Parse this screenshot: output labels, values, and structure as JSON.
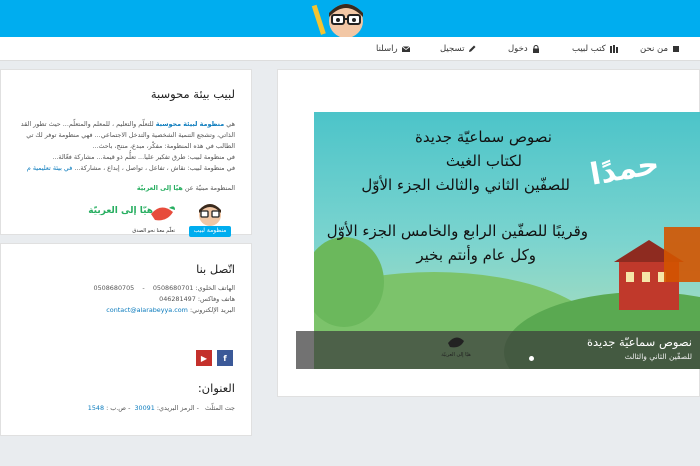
{
  "nav": {
    "items": [
      {
        "label": "من نحن",
        "icon": "book-icon"
      },
      {
        "label": "كتب لبيب",
        "icon": "books-icon"
      },
      {
        "label": "دخول",
        "icon": "lock-icon"
      },
      {
        "label": "تسجيل",
        "icon": "pencil-icon"
      },
      {
        "label": "راسلنا",
        "icon": "envelope-icon"
      }
    ]
  },
  "about": {
    "title": "لبيب بيئة محوسبة",
    "line1_pre": "هي ",
    "line1_hl": "منظومة لبيئة محوسبة",
    "line1_post": " للتعلّم والتعليم ، للمعلم والمتعلّم... حيث تطور القد",
    "line2": "الذاتي، وتشجع التنمية الشخصية والتدخل الاجتماعي... فهي منظومة توفر لك تي",
    "line3": "الطالب في هذه المنظومة: مفكّر، مبدع، منتج، باحث...",
    "line4": "في منظومة لبيب: طرق تفكير عليا... تعلُّم ذو قيمة... مشاركة فعّالة...",
    "line5_pre": "في منظومة لبيب: نقاش ، تفاعل ، تواصل ، إبداع ، مشاركة... ",
    "line5_hl": "في بيئة تعليمية م",
    "partner_pre": "المنظومة مبنيّة عن ",
    "partner_hl": "هيّا إلى العربيّة",
    "logo_labib": "منظومة لبيب",
    "logo_hayya": "هيّا إلى العربيّة",
    "logo_hayya_sub": "تعلّم معنا نحو الصدق"
  },
  "contact": {
    "title": "اتّصل بنا",
    "phone_label": "الهاتف الخلوي:",
    "phone1": "0508680701",
    "phone_sep": "-",
    "phone2": "0508680705",
    "fax_label": "هاتف وفاكس:",
    "fax": "046281497",
    "email_label": "البريد الإلكتروني:",
    "email": "contact@alarabeyya.com",
    "address_title": "العنوان:",
    "address_city": "جت المثلّث",
    "address_zip_label": "- الرمز البريدي:",
    "address_zip": "30091",
    "address_po_label": "- ص.ب :",
    "address_po": "1548"
  },
  "slide": {
    "line1": "نصوص سماعيّة جديدة",
    "line2": "لكتاب الغيث",
    "line3": "للصفّين الثاني والثالث الجزء الأوّل",
    "line4": "وقريبًا للصفّين الرابع والخامس الجزء الأوّل",
    "line5": "وكل عام وأنتم بخير",
    "greeting": "حمدًا",
    "caption_title": "نصوص سماعيّة جديدة",
    "caption_sub": "للصفّين الثاني والثالث",
    "caption_logo": "هيّا إلى العربيّة"
  },
  "colors": {
    "topbar": "#00adef",
    "link": "#0b7bbd",
    "facebook": "#3b5998",
    "youtube": "#c4302b"
  }
}
